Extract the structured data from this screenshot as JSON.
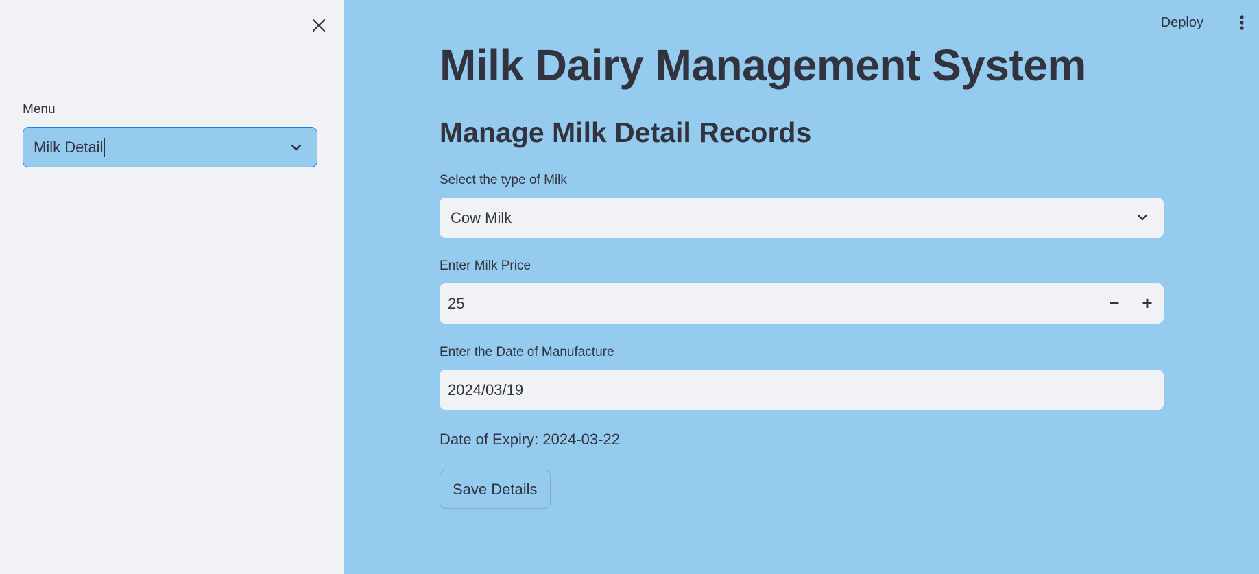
{
  "sidebar": {
    "close_icon": "close-icon",
    "menu_label": "Menu",
    "menu_selected": "Milk Detail",
    "chevron_icon": "chevron-down-icon"
  },
  "topbar": {
    "deploy_label": "Deploy",
    "menu_icon": "vertical-dots-icon"
  },
  "main": {
    "title": "Milk Dairy Management System",
    "section_title": "Manage Milk Detail Records",
    "milk_type": {
      "label": "Select the type of Milk",
      "value": "Cow Milk"
    },
    "milk_price": {
      "label": "Enter Milk Price",
      "value": "25",
      "minus_symbol": "−",
      "plus_symbol": "+"
    },
    "manufacture_date": {
      "label": "Enter the Date of Manufacture",
      "value": "2024/03/19"
    },
    "expiry_text": "Date of Expiry: 2024-03-22",
    "save_button_label": "Save Details"
  },
  "colors": {
    "sidebar_bg": "#f0f2f6",
    "main_bg": "#95cbef",
    "text": "#31333f",
    "focus_border": "#1c83e1",
    "input_bg": "#f0f2f6"
  }
}
